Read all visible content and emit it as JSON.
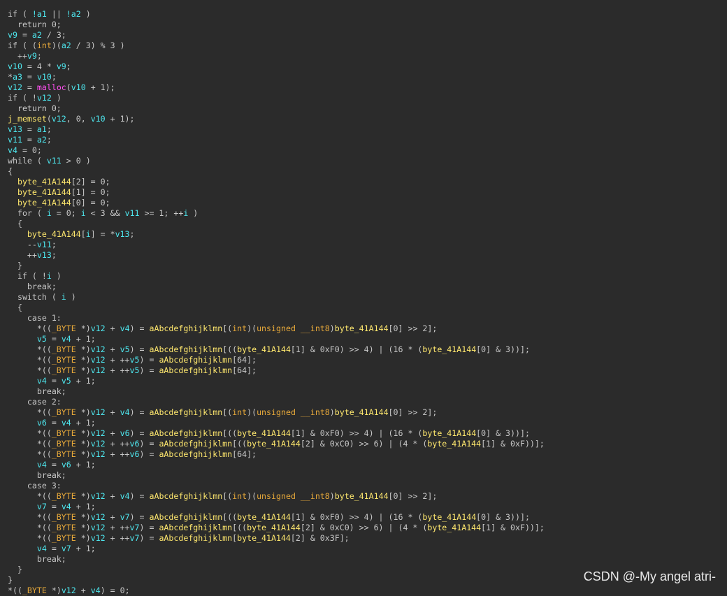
{
  "code_lines": [
    [
      [
        "d",
        "if ( "
      ],
      [
        "v",
        "!a1"
      ],
      [
        "d",
        " || "
      ],
      [
        "v",
        "!a2"
      ],
      [
        "d",
        " )"
      ]
    ],
    [
      [
        "d",
        "  return 0;"
      ]
    ],
    [
      [
        "v",
        "v9"
      ],
      [
        "d",
        " = "
      ],
      [
        "v",
        "a2"
      ],
      [
        "d",
        " / 3;"
      ]
    ],
    [
      [
        "d",
        "if ( ("
      ],
      [
        "o",
        "int"
      ],
      [
        "d",
        ")("
      ],
      [
        "v",
        "a2"
      ],
      [
        "d",
        " / 3) % 3 )"
      ]
    ],
    [
      [
        "d",
        "  ++"
      ],
      [
        "v",
        "v9"
      ],
      [
        "d",
        ";"
      ]
    ],
    [
      [
        "v",
        "v10"
      ],
      [
        "d",
        " = 4 * "
      ],
      [
        "v",
        "v9"
      ],
      [
        "d",
        ";"
      ]
    ],
    [
      [
        "d",
        "*"
      ],
      [
        "v",
        "a3"
      ],
      [
        "d",
        " = "
      ],
      [
        "v",
        "v10"
      ],
      [
        "d",
        ";"
      ]
    ],
    [
      [
        "v",
        "v12"
      ],
      [
        "d",
        " = "
      ],
      [
        "m",
        "malloc"
      ],
      [
        "d",
        "("
      ],
      [
        "v",
        "v10"
      ],
      [
        "d",
        " + 1);"
      ]
    ],
    [
      [
        "d",
        "if ( !"
      ],
      [
        "v",
        "v12"
      ],
      [
        "d",
        " )"
      ]
    ],
    [
      [
        "d",
        "  return 0;"
      ]
    ],
    [
      [
        "y",
        "j_memset"
      ],
      [
        "d",
        "("
      ],
      [
        "v",
        "v12"
      ],
      [
        "d",
        ", 0, "
      ],
      [
        "v",
        "v10"
      ],
      [
        "d",
        " + 1);"
      ]
    ],
    [
      [
        "v",
        "v13"
      ],
      [
        "d",
        " = "
      ],
      [
        "v",
        "a1"
      ],
      [
        "d",
        ";"
      ]
    ],
    [
      [
        "v",
        "v11"
      ],
      [
        "d",
        " = "
      ],
      [
        "v",
        "a2"
      ],
      [
        "d",
        ";"
      ]
    ],
    [
      [
        "v",
        "v4"
      ],
      [
        "d",
        " = 0;"
      ]
    ],
    [
      [
        "d",
        "while ( "
      ],
      [
        "v",
        "v11"
      ],
      [
        "d",
        " > 0 )"
      ]
    ],
    [
      [
        "d",
        "{"
      ]
    ],
    [
      [
        "d",
        "  "
      ],
      [
        "y",
        "byte_41A144"
      ],
      [
        "d",
        "[2] = 0;"
      ]
    ],
    [
      [
        "d",
        "  "
      ],
      [
        "y",
        "byte_41A144"
      ],
      [
        "d",
        "[1] = 0;"
      ]
    ],
    [
      [
        "d",
        "  "
      ],
      [
        "y",
        "byte_41A144"
      ],
      [
        "d",
        "[0] = 0;"
      ]
    ],
    [
      [
        "d",
        "  for ( "
      ],
      [
        "v",
        "i"
      ],
      [
        "d",
        " = 0; "
      ],
      [
        "v",
        "i"
      ],
      [
        "d",
        " < 3 && "
      ],
      [
        "v",
        "v11"
      ],
      [
        "d",
        " >= 1; ++"
      ],
      [
        "v",
        "i"
      ],
      [
        "d",
        " )"
      ]
    ],
    [
      [
        "d",
        "  {"
      ]
    ],
    [
      [
        "d",
        "    "
      ],
      [
        "y",
        "byte_41A144"
      ],
      [
        "d",
        "["
      ],
      [
        "v",
        "i"
      ],
      [
        "d",
        "] = *"
      ],
      [
        "v",
        "v13"
      ],
      [
        "d",
        ";"
      ]
    ],
    [
      [
        "d",
        "    --"
      ],
      [
        "v",
        "v11"
      ],
      [
        "d",
        ";"
      ]
    ],
    [
      [
        "d",
        "    ++"
      ],
      [
        "v",
        "v13"
      ],
      [
        "d",
        ";"
      ]
    ],
    [
      [
        "d",
        "  }"
      ]
    ],
    [
      [
        "d",
        "  if ( !"
      ],
      [
        "v",
        "i"
      ],
      [
        "d",
        " )"
      ]
    ],
    [
      [
        "d",
        "    break;"
      ]
    ],
    [
      [
        "d",
        "  switch ( "
      ],
      [
        "v",
        "i"
      ],
      [
        "d",
        " )"
      ]
    ],
    [
      [
        "d",
        "  {"
      ]
    ],
    [
      [
        "d",
        "    case 1:"
      ]
    ],
    [
      [
        "d",
        "      *(("
      ],
      [
        "o",
        "_BYTE"
      ],
      [
        "d",
        " *)"
      ],
      [
        "v",
        "v12"
      ],
      [
        "d",
        " + "
      ],
      [
        "v",
        "v4"
      ],
      [
        "d",
        ") = "
      ],
      [
        "y",
        "aAbcdefghijklmn"
      ],
      [
        "d",
        "[("
      ],
      [
        "o",
        "int"
      ],
      [
        "d",
        ")("
      ],
      [
        "o",
        "unsigned __int8"
      ],
      [
        "d",
        ")"
      ],
      [
        "y",
        "byte_41A144"
      ],
      [
        "d",
        "[0] >> 2];"
      ]
    ],
    [
      [
        "d",
        "      "
      ],
      [
        "v",
        "v5"
      ],
      [
        "d",
        " = "
      ],
      [
        "v",
        "v4"
      ],
      [
        "d",
        " + 1;"
      ]
    ],
    [
      [
        "d",
        "      *(("
      ],
      [
        "o",
        "_BYTE"
      ],
      [
        "d",
        " *)"
      ],
      [
        "v",
        "v12"
      ],
      [
        "d",
        " + "
      ],
      [
        "v",
        "v5"
      ],
      [
        "d",
        ") = "
      ],
      [
        "y",
        "aAbcdefghijklmn"
      ],
      [
        "d",
        "[(("
      ],
      [
        "y",
        "byte_41A144"
      ],
      [
        "d",
        "[1] & 0xF0) >> 4) | (16 * ("
      ],
      [
        "y",
        "byte_41A144"
      ],
      [
        "d",
        "[0] & 3))];"
      ]
    ],
    [
      [
        "d",
        "      *(("
      ],
      [
        "o",
        "_BYTE"
      ],
      [
        "d",
        " *)"
      ],
      [
        "v",
        "v12"
      ],
      [
        "d",
        " + ++"
      ],
      [
        "v",
        "v5"
      ],
      [
        "d",
        ") = "
      ],
      [
        "y",
        "aAbcdefghijklmn"
      ],
      [
        "d",
        "[64];"
      ]
    ],
    [
      [
        "d",
        "      *(("
      ],
      [
        "o",
        "_BYTE"
      ],
      [
        "d",
        " *)"
      ],
      [
        "v",
        "v12"
      ],
      [
        "d",
        " + ++"
      ],
      [
        "v",
        "v5"
      ],
      [
        "d",
        ") = "
      ],
      [
        "y",
        "aAbcdefghijklmn"
      ],
      [
        "d",
        "[64];"
      ]
    ],
    [
      [
        "d",
        "      "
      ],
      [
        "v",
        "v4"
      ],
      [
        "d",
        " = "
      ],
      [
        "v",
        "v5"
      ],
      [
        "d",
        " + 1;"
      ]
    ],
    [
      [
        "d",
        "      break;"
      ]
    ],
    [
      [
        "d",
        "    case 2:"
      ]
    ],
    [
      [
        "d",
        "      *(("
      ],
      [
        "o",
        "_BYTE"
      ],
      [
        "d",
        " *)"
      ],
      [
        "v",
        "v12"
      ],
      [
        "d",
        " + "
      ],
      [
        "v",
        "v4"
      ],
      [
        "d",
        ") = "
      ],
      [
        "y",
        "aAbcdefghijklmn"
      ],
      [
        "d",
        "[("
      ],
      [
        "o",
        "int"
      ],
      [
        "d",
        ")("
      ],
      [
        "o",
        "unsigned __int8"
      ],
      [
        "d",
        ")"
      ],
      [
        "y",
        "byte_41A144"
      ],
      [
        "d",
        "[0] >> 2];"
      ]
    ],
    [
      [
        "d",
        "      "
      ],
      [
        "v",
        "v6"
      ],
      [
        "d",
        " = "
      ],
      [
        "v",
        "v4"
      ],
      [
        "d",
        " + 1;"
      ]
    ],
    [
      [
        "d",
        "      *(("
      ],
      [
        "o",
        "_BYTE"
      ],
      [
        "d",
        " *)"
      ],
      [
        "v",
        "v12"
      ],
      [
        "d",
        " + "
      ],
      [
        "v",
        "v6"
      ],
      [
        "d",
        ") = "
      ],
      [
        "y",
        "aAbcdefghijklmn"
      ],
      [
        "d",
        "[(("
      ],
      [
        "y",
        "byte_41A144"
      ],
      [
        "d",
        "[1] & 0xF0) >> 4) | (16 * ("
      ],
      [
        "y",
        "byte_41A144"
      ],
      [
        "d",
        "[0] & 3))];"
      ]
    ],
    [
      [
        "d",
        "      *(("
      ],
      [
        "o",
        "_BYTE"
      ],
      [
        "d",
        " *)"
      ],
      [
        "v",
        "v12"
      ],
      [
        "d",
        " + ++"
      ],
      [
        "v",
        "v6"
      ],
      [
        "d",
        ") = "
      ],
      [
        "y",
        "aAbcdefghijklmn"
      ],
      [
        "d",
        "[(("
      ],
      [
        "y",
        "byte_41A144"
      ],
      [
        "d",
        "[2] & 0xC0) >> 6) | (4 * ("
      ],
      [
        "y",
        "byte_41A144"
      ],
      [
        "d",
        "[1] & 0xF))];"
      ]
    ],
    [
      [
        "d",
        "      *(("
      ],
      [
        "o",
        "_BYTE"
      ],
      [
        "d",
        " *)"
      ],
      [
        "v",
        "v12"
      ],
      [
        "d",
        " + ++"
      ],
      [
        "v",
        "v6"
      ],
      [
        "d",
        ") = "
      ],
      [
        "y",
        "aAbcdefghijklmn"
      ],
      [
        "d",
        "[64];"
      ]
    ],
    [
      [
        "d",
        "      "
      ],
      [
        "v",
        "v4"
      ],
      [
        "d",
        " = "
      ],
      [
        "v",
        "v6"
      ],
      [
        "d",
        " + 1;"
      ]
    ],
    [
      [
        "d",
        "      break;"
      ]
    ],
    [
      [
        "d",
        "    case 3:"
      ]
    ],
    [
      [
        "d",
        "      *(("
      ],
      [
        "o",
        "_BYTE"
      ],
      [
        "d",
        " *)"
      ],
      [
        "v",
        "v12"
      ],
      [
        "d",
        " + "
      ],
      [
        "v",
        "v4"
      ],
      [
        "d",
        ") = "
      ],
      [
        "y",
        "aAbcdefghijklmn"
      ],
      [
        "d",
        "[("
      ],
      [
        "o",
        "int"
      ],
      [
        "d",
        ")("
      ],
      [
        "o",
        "unsigned __int8"
      ],
      [
        "d",
        ")"
      ],
      [
        "y",
        "byte_41A144"
      ],
      [
        "d",
        "[0] >> 2];"
      ]
    ],
    [
      [
        "d",
        "      "
      ],
      [
        "v",
        "v7"
      ],
      [
        "d",
        " = "
      ],
      [
        "v",
        "v4"
      ],
      [
        "d",
        " + 1;"
      ]
    ],
    [
      [
        "d",
        "      *(("
      ],
      [
        "o",
        "_BYTE"
      ],
      [
        "d",
        " *)"
      ],
      [
        "v",
        "v12"
      ],
      [
        "d",
        " + "
      ],
      [
        "v",
        "v7"
      ],
      [
        "d",
        ") = "
      ],
      [
        "y",
        "aAbcdefghijklmn"
      ],
      [
        "d",
        "[(("
      ],
      [
        "y",
        "byte_41A144"
      ],
      [
        "d",
        "[1] & 0xF0) >> 4) | (16 * ("
      ],
      [
        "y",
        "byte_41A144"
      ],
      [
        "d",
        "[0] & 3))];"
      ]
    ],
    [
      [
        "d",
        "      *(("
      ],
      [
        "o",
        "_BYTE"
      ],
      [
        "d",
        " *)"
      ],
      [
        "v",
        "v12"
      ],
      [
        "d",
        " + ++"
      ],
      [
        "v",
        "v7"
      ],
      [
        "d",
        ") = "
      ],
      [
        "y",
        "aAbcdefghijklmn"
      ],
      [
        "d",
        "[(("
      ],
      [
        "y",
        "byte_41A144"
      ],
      [
        "d",
        "[2] & 0xC0) >> 6) | (4 * ("
      ],
      [
        "y",
        "byte_41A144"
      ],
      [
        "d",
        "[1] & 0xF))];"
      ]
    ],
    [
      [
        "d",
        "      *(("
      ],
      [
        "o",
        "_BYTE"
      ],
      [
        "d",
        " *)"
      ],
      [
        "v",
        "v12"
      ],
      [
        "d",
        " + ++"
      ],
      [
        "v",
        "v7"
      ],
      [
        "d",
        ") = "
      ],
      [
        "y",
        "aAbcdefghijklmn"
      ],
      [
        "d",
        "["
      ],
      [
        "y",
        "byte_41A144"
      ],
      [
        "d",
        "[2] & 0x3F];"
      ]
    ],
    [
      [
        "d",
        "      "
      ],
      [
        "v",
        "v4"
      ],
      [
        "d",
        " = "
      ],
      [
        "v",
        "v7"
      ],
      [
        "d",
        " + 1;"
      ]
    ],
    [
      [
        "d",
        "      break;"
      ]
    ],
    [
      [
        "d",
        "  }"
      ]
    ],
    [
      [
        "d",
        "}"
      ]
    ],
    [
      [
        "d",
        "*(("
      ],
      [
        "o",
        "_BYTE"
      ],
      [
        "d",
        " *)"
      ],
      [
        "v",
        "v12"
      ],
      [
        "d",
        " + "
      ],
      [
        "v",
        "v4"
      ],
      [
        "d",
        ") = 0;"
      ]
    ]
  ],
  "watermark": "CSDN @-My angel atri-",
  "colors": {
    "background": "#2b2b2b",
    "default_text": "#c8c8c8",
    "variable": "#4ee8f0",
    "global_symbol": "#ffe86e",
    "type_keyword": "#e6a83a",
    "library_function": "#ff4ff0"
  }
}
